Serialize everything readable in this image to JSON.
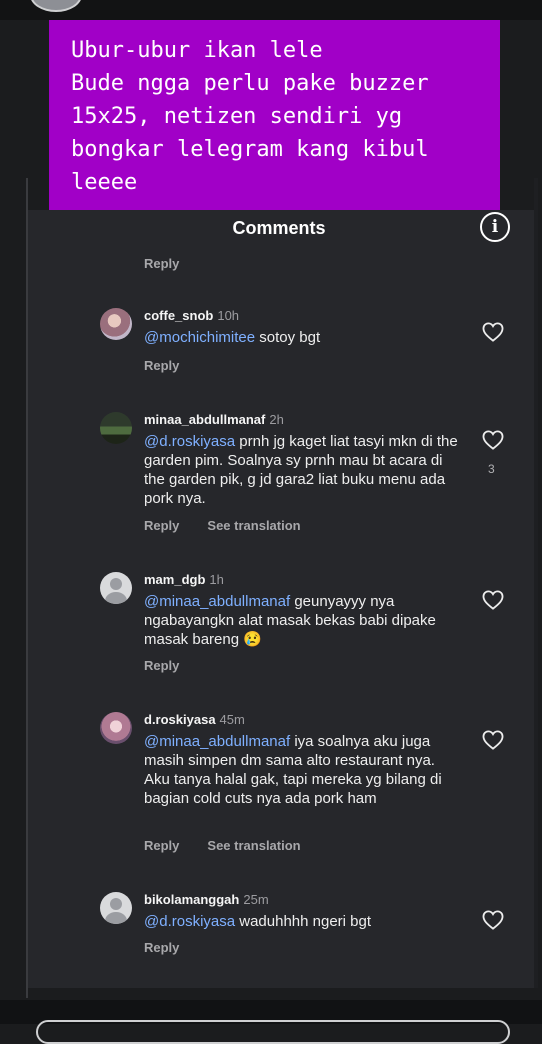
{
  "story": {
    "caption_lines": [
      "Ubur-ubur ikan lele",
      "Bude ngga perlu pake buzzer",
      "15x25, netizen sendiri yg",
      "bongkar lelegram kang kibul",
      "leeee"
    ]
  },
  "sheet": {
    "title": "Comments",
    "info_icon": "i",
    "top_reply": "Reply"
  },
  "comments": [
    {
      "user": "coffe_snob",
      "time": "10h",
      "mention": "@mochichimitee",
      "text": " sotoy bgt",
      "reply": "Reply",
      "see_translation": "",
      "likes": ""
    },
    {
      "user": "minaa_abdullmanaf",
      "time": "2h",
      "mention": "@d.roskiyasa",
      "text": " prnh jg kaget liat tasyi mkn di the garden pim. Soalnya sy prnh mau bt acara di the garden pik, g jd gara2 liat buku menu ada pork nya.",
      "reply": "Reply",
      "see_translation": "See translation",
      "likes": "3"
    },
    {
      "user": "mam_dgb",
      "time": "1h",
      "mention": "@minaa_abdullmanaf",
      "text": " geunyayyy nya ngabayangkn alat masak bekas babi dipake masak bareng 😢",
      "reply": "Reply",
      "see_translation": "",
      "likes": ""
    },
    {
      "user": "d.roskiyasa",
      "time": "45m",
      "mention": "@minaa_abdullmanaf",
      "text": " iya soalnya aku juga masih simpen dm sama alto restaurant nya. Aku tanya halal gak, tapi mereka yg bilang di bagian cold cuts nya ada pork ham",
      "reply": "Reply",
      "see_translation": "See translation",
      "likes": ""
    },
    {
      "user": "bikolamanggah",
      "time": "25m",
      "mention": "@d.roskiyasa",
      "text": " waduhhhh ngeri bgt",
      "reply": "Reply",
      "see_translation": "",
      "likes": ""
    }
  ],
  "colors": {
    "caption_bg": "#a100c7",
    "panel_bg": "#26272b",
    "mention": "#7fb0ff"
  },
  "icons": [
    "info-icon",
    "heart-outline-icon",
    "default-avatar-icon"
  ]
}
